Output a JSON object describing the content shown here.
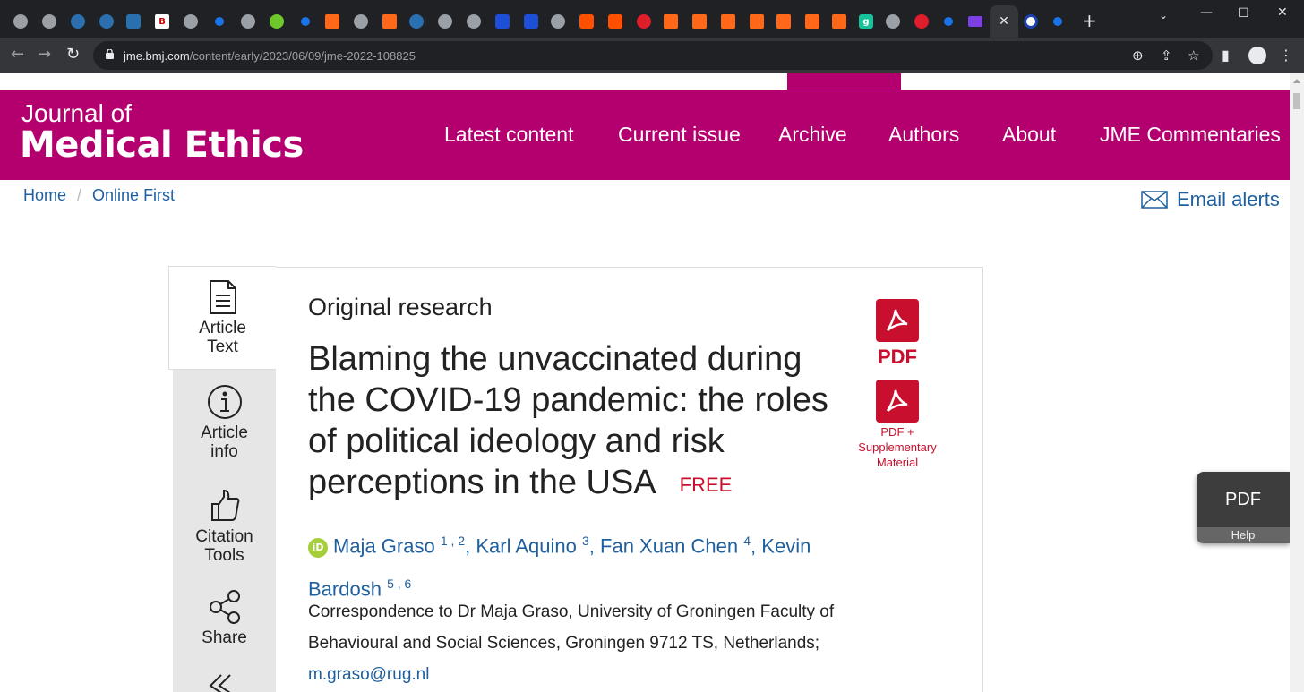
{
  "browser": {
    "url_host": "jme.bmj.com",
    "url_path": "/content/early/2023/06/09/jme-2022-108825",
    "tab_close": "✕",
    "new_tab": "+"
  },
  "site": {
    "logo_top": "Journal of",
    "logo_main": "Medical Ethics",
    "nav": [
      "Latest content",
      "Current issue",
      "Archive",
      "Authors",
      "About",
      "JME Commentaries"
    ],
    "accent_color": "#b4006f"
  },
  "breadcrumb": {
    "home": "Home",
    "sep": "/",
    "current": "Online First"
  },
  "email_alerts": "Email alerts",
  "sidenav": {
    "items": [
      {
        "line1": "Article",
        "line2": "Text"
      },
      {
        "line1": "Article",
        "line2": "info"
      },
      {
        "line1": "Citation",
        "line2": "Tools"
      },
      {
        "line1": "Share",
        "line2": ""
      }
    ]
  },
  "article": {
    "type": "Original research",
    "title": "Blaming the unvaccinated during the COVID-19 pandemic: the roles of political ideology and risk perceptions in the USA",
    "free": "FREE",
    "authors": [
      {
        "name": "Maja Graso",
        "sup": "1 , 2"
      },
      {
        "name": "Karl Aquino",
        "sup": "3"
      },
      {
        "name": "Fan Xuan Chen",
        "sup": "4"
      },
      {
        "name": "Kevin Bardosh",
        "sup": "5 , 6"
      }
    ],
    "orcid_label": "iD",
    "correspondence": "Correspondence to Dr Maja Graso, University of Groningen Faculty of Behavioural and Social Sciences, Groningen 9712 TS, Netherlands;",
    "email": "m.graso@rug.nl"
  },
  "pdf": {
    "label": "PDF",
    "supp_label": "PDF + Supplementary Material"
  },
  "pdf_help": {
    "label": "PDF",
    "help": "Help"
  }
}
